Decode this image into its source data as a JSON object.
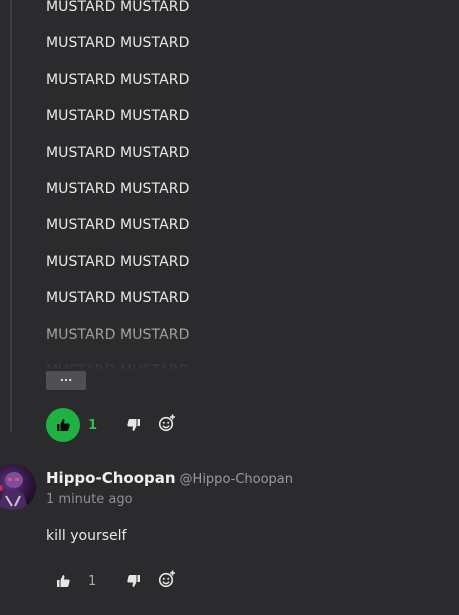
{
  "comment": {
    "lines": [
      "MUSTARD MUSTARD",
      "MUSTARD MUSTARD",
      "MUSTARD MUSTARD",
      "MUSTARD MUSTARD",
      "MUSTARD MUSTARD",
      "MUSTARD MUSTARD",
      "MUSTARD MUSTARD",
      "MUSTARD MUSTARD",
      "MUSTARD MUSTARD",
      "MUSTARD MUSTARD",
      "MUSTARD MUSTARD"
    ],
    "expand_label": "...",
    "likes": "1",
    "liked": true
  },
  "reply": {
    "username": "Hippo-Choopan",
    "handle": "@Hippo-Choopan",
    "timestamp": "1 minute ago",
    "text": "kill yourself",
    "likes": "1",
    "liked": false
  },
  "colors": {
    "background": "#2b2b2d",
    "like_active": "#1fb141",
    "like_count_active": "#2ec14f",
    "expand_button": "#505054"
  },
  "icons": {
    "like": "thumbs-up-icon",
    "dislike": "thumbs-down-icon",
    "react": "add-reaction-icon"
  }
}
